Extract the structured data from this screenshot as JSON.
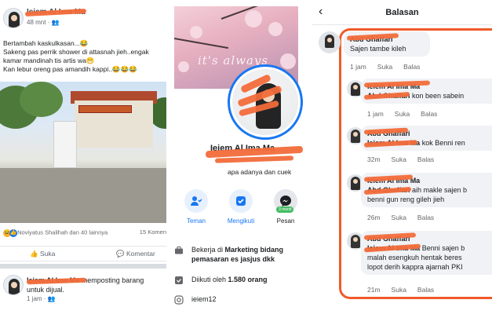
{
  "post": {
    "author": "Ieiem Al Ima Ma",
    "time": "48 mnt",
    "separator": "·",
    "text_lines": [
      "Bertambah kaskulkasan...😂",
      "Sakeng pas perrik shower di attasnah jieh..engak",
      "kamar mandinah tis artis wa😁",
      "Kan lebur oreng pas amandih kappi..😂😂😂"
    ],
    "reactions_text": "Noviyatus Shalihah dan 40 lainnya",
    "comments_count": "15 Komen",
    "like_label": "Suka",
    "comment_label": "Komentar"
  },
  "post2": {
    "author": "Ieiem Al Ima Ma",
    "action": "memposting barang",
    "action2": "untuk dijual.",
    "time": "1 jam",
    "separator": "·"
  },
  "profile": {
    "cover_text": "it's always",
    "name": "Ieiem Al Ima Ma",
    "bio": "apa adanya dan cuek",
    "buttons": [
      {
        "label": "Teman",
        "icon": "friends-icon"
      },
      {
        "label": "Mengikuti",
        "icon": "following-icon"
      },
      {
        "label": "Pesan",
        "icon": "messenger-icon",
        "badge": "3 menit"
      }
    ],
    "work_prefix": "Bekerja di ",
    "work_place": "Marketing bidang pemasaran es jasjus dkk",
    "followers_prefix": "Diikuti oleh ",
    "followers_count": "1.580 orang",
    "instagram": "ieiem12"
  },
  "replies": {
    "title": "Balasan",
    "root": {
      "author": "Abd Ghaffari",
      "text": "Sajen tambe kileh",
      "time": "1 jam",
      "like": "Suka",
      "reply": "Balas"
    },
    "items": [
      {
        "author": "Ieiem Al Ima Ma",
        "mention": "Abd Ghaffari",
        "text": " kon been sabein",
        "time": "1 jam",
        "like": "Suka",
        "reply": "Balas"
      },
      {
        "author": "Abd Ghaffari",
        "mention": "Ieiem Al Ima Ma",
        "text": " kok Benni ren",
        "time": "32m",
        "like": "Suka",
        "reply": "Balas"
      },
      {
        "author": "Ieiem Al Ima Ma",
        "mention": "Abd Ghaffari",
        "text": " aih makle sajen b",
        "text2": "benni gun reng gileh jieh",
        "time": "26m",
        "like": "Suka",
        "reply": "Balas"
      },
      {
        "author": "Abd Ghaffari",
        "mention": "Ieiem Al Ima Ma",
        "text": " Benni sajen b",
        "text2": "malah esengkuh hentak beres",
        "text3": "lopot derih kappra ajarnah PKI",
        "time": "21m",
        "like": "Suka",
        "reply": "Balas"
      }
    ]
  },
  "colors": {
    "accent": "#1877f2",
    "scribble": "#f26b3a",
    "redline": "#f05a2a"
  }
}
